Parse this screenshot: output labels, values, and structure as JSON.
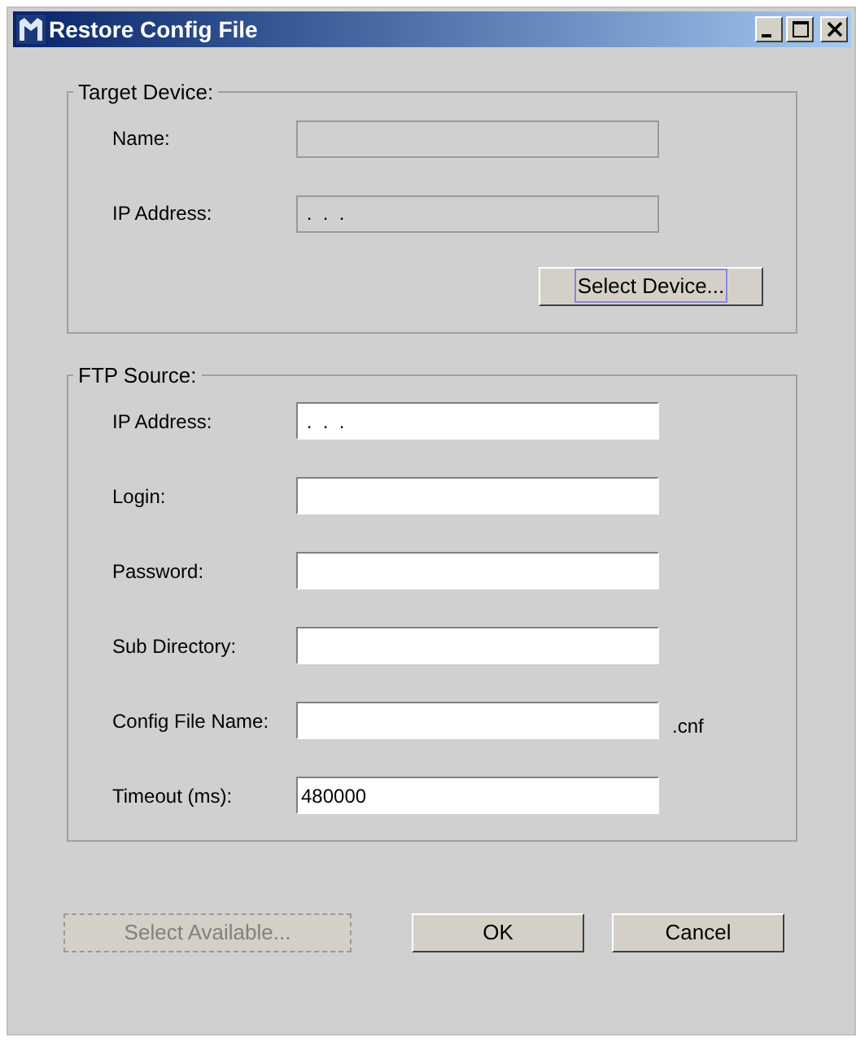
{
  "window": {
    "title": "Restore Config File",
    "controls": [
      {
        "kind": "minimize"
      },
      {
        "kind": "maximize"
      },
      {
        "kind": "close"
      }
    ]
  },
  "target_device": {
    "title": "Target Device:",
    "fields": [
      {
        "label": "Name:",
        "disabled": true
      },
      {
        "label": "IP Address:",
        "value": " .  .  .",
        "disabled": true
      }
    ],
    "button": {
      "label": "Select Device...",
      "focused": true
    }
  },
  "ftp_source": {
    "title": "FTP Source:",
    "fields": [
      {
        "label": "IP Address:",
        "value": " .  .  .",
        "disabled": false
      },
      {
        "label": "Login:",
        "disabled": false
      },
      {
        "label": "Password:",
        "disabled": false
      },
      {
        "label": "Sub Directory:",
        "disabled": false
      },
      {
        "label": "Config File Name:",
        "disabled": false,
        "suffix": ".cnf"
      },
      {
        "label": "Timeout (ms):",
        "value": "480000",
        "disabled": false
      }
    ]
  },
  "buttons": [
    {
      "label": "Select Available...",
      "disabled": true
    },
    {
      "label": "OK",
      "disabled": false
    },
    {
      "label": "Cancel",
      "disabled": false
    }
  ]
}
